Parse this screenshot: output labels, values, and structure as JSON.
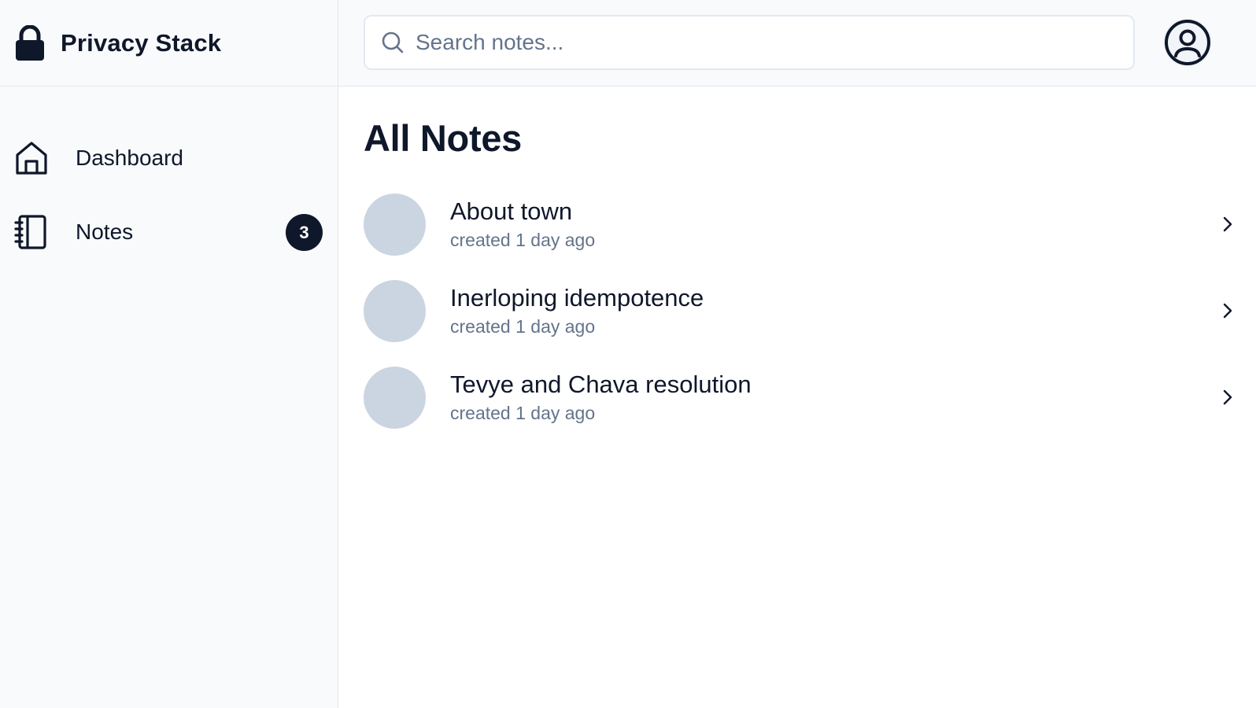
{
  "app": {
    "title": "Privacy Stack"
  },
  "sidebar": {
    "items": [
      {
        "label": "Dashboard",
        "icon": "home-icon"
      },
      {
        "label": "Notes",
        "icon": "notebook-icon",
        "badge": "3"
      }
    ]
  },
  "search": {
    "placeholder": "Search notes...",
    "value": ""
  },
  "user": {
    "icon": "user-circle-icon"
  },
  "main": {
    "title": "All Notes",
    "notes": [
      {
        "title": "About town",
        "meta": "created 1 day ago"
      },
      {
        "title": "Inerloping idempotence",
        "meta": "created 1 day ago"
      },
      {
        "title": "Tevye and Chava resolution",
        "meta": "created 1 day ago"
      }
    ]
  },
  "colors": {
    "primary": "#0f172a",
    "muted": "#64748b",
    "sidebar_bg": "#f8fafc",
    "border": "#e2e8f0",
    "thumb": "#cbd5e1"
  }
}
